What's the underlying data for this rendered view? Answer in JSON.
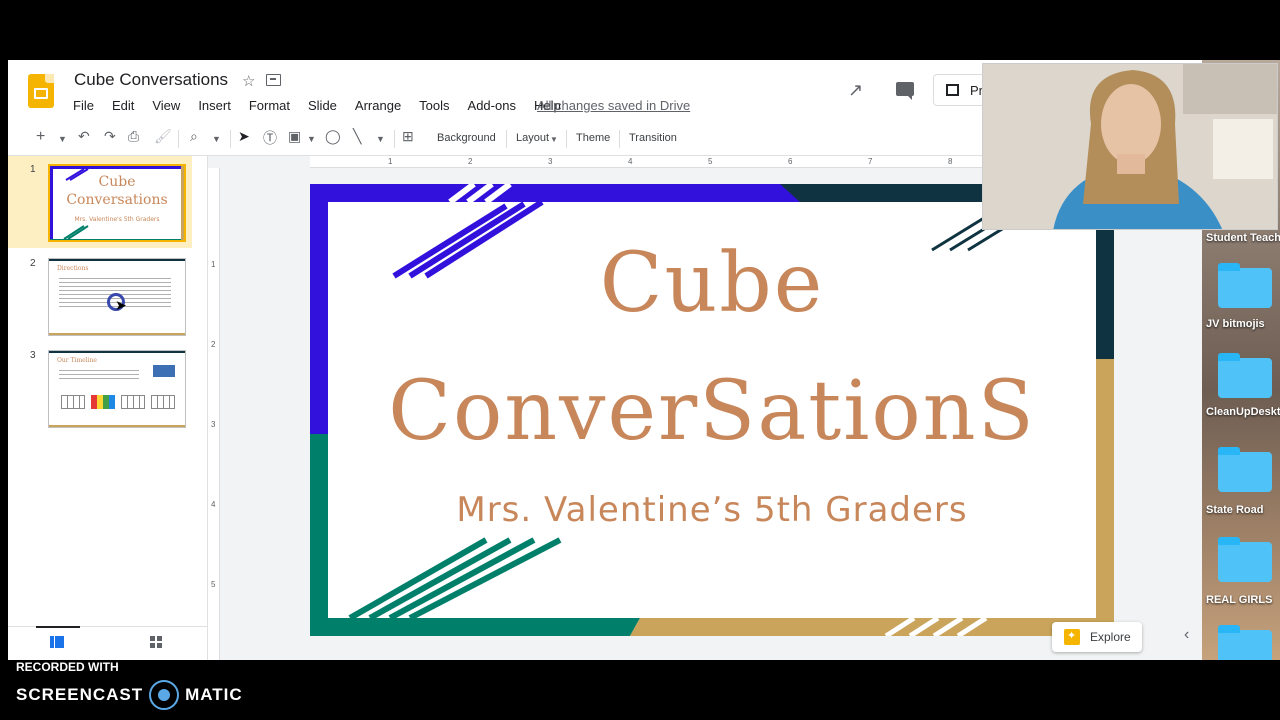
{
  "doc": {
    "title": "Cube Conversations",
    "save_status": "All changes saved in Drive"
  },
  "menu": [
    "File",
    "Edit",
    "View",
    "Insert",
    "Format",
    "Slide",
    "Arrange",
    "Tools",
    "Add-ons",
    "Help"
  ],
  "present": {
    "label": "Pr"
  },
  "toolbar": {
    "background": "Background",
    "layout": "Layout",
    "theme": "Theme",
    "transition": "Transition"
  },
  "slides": [
    {
      "num": "1",
      "title_line1": "Cube",
      "title_line2": "Conversations",
      "subtitle": "Mrs. Valentine's 5th Graders"
    },
    {
      "num": "2",
      "heading": "Directions"
    },
    {
      "num": "3",
      "heading": "Our Timeline"
    }
  ],
  "main_slide": {
    "title_line1": "Cube",
    "title_line2": "ConverSationS",
    "subtitle": "Mrs. Valentine’s 5th Graders"
  },
  "ruler": {
    "top": [
      "1",
      "2",
      "3",
      "4",
      "5",
      "6",
      "7",
      "8"
    ],
    "left": [
      "1",
      "2",
      "3",
      "4",
      "5"
    ]
  },
  "explore": {
    "label": "Explore"
  },
  "desktop": {
    "labels": [
      "Student Teache",
      "JV bitmojis",
      "CleanUpDeskt",
      "State Road",
      "REAL GIRLS"
    ]
  },
  "watermark": {
    "recorded": "RECORDED WITH",
    "brand_left": "SCREENCAST",
    "brand_right": "MATIC"
  },
  "colors": {
    "accent_yellow": "#f4b400",
    "slide_text": "#c8875a",
    "purple": "#3311dd",
    "teal": "#00806a",
    "gold": "#c9a45a",
    "navy": "#0f3340"
  }
}
